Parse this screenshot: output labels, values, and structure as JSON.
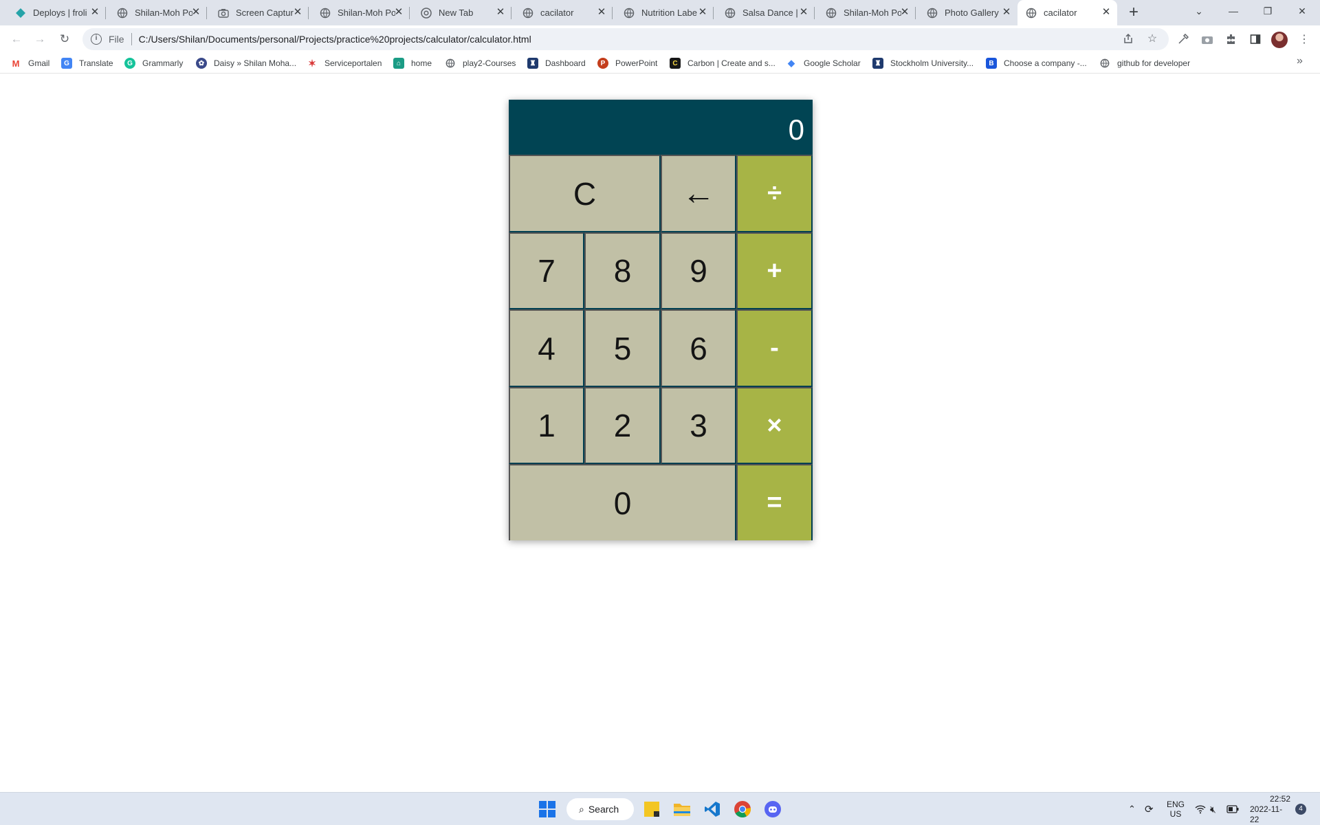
{
  "browser": {
    "tabs": [
      {
        "title": "Deploys | froli",
        "icon": "netlify-icon",
        "active": false
      },
      {
        "title": "Shilan-Moh Po",
        "icon": "globe-icon",
        "active": false
      },
      {
        "title": "Screen Captur",
        "icon": "camera-icon",
        "active": false
      },
      {
        "title": "Shilan-Moh Po",
        "icon": "globe-icon",
        "active": false
      },
      {
        "title": "New Tab",
        "icon": "chrome-icon",
        "active": false
      },
      {
        "title": "cacilator",
        "icon": "globe-icon",
        "active": false
      },
      {
        "title": "Nutrition Labe",
        "icon": "globe-icon",
        "active": false
      },
      {
        "title": "Salsa Dance |",
        "icon": "globe-icon",
        "active": false
      },
      {
        "title": "Shilan-Moh Po",
        "icon": "globe-icon",
        "active": false
      },
      {
        "title": "Photo Gallery",
        "icon": "globe-icon",
        "active": false
      },
      {
        "title": "cacilator",
        "icon": "globe-icon",
        "active": true
      }
    ],
    "omnibox": {
      "scheme": "File",
      "url": "C:/Users/Shilan/Documents/personal/Projects/practice%20projects/calculator/calculator.html"
    },
    "bookmarks": [
      {
        "label": "Gmail",
        "icon": "gmail-icon",
        "color": "#ea4335"
      },
      {
        "label": "Translate",
        "icon": "translate-icon",
        "color": "#4285f4"
      },
      {
        "label": "Grammarly",
        "icon": "grammarly-icon",
        "color": "#15c39a"
      },
      {
        "label": "Daisy » Shilan Moha...",
        "icon": "daisy-icon",
        "color": "#3b4a8a"
      },
      {
        "label": "Serviceportalen",
        "icon": "star-logo-icon",
        "color": "#d93a3a"
      },
      {
        "label": "home",
        "icon": "home-logo-icon",
        "color": "#1b9c85"
      },
      {
        "label": "play2-Courses",
        "icon": "globe-icon",
        "color": "#5f6368"
      },
      {
        "label": "Dashboard",
        "icon": "university-icon",
        "color": "#1f3a6e"
      },
      {
        "label": "PowerPoint",
        "icon": "powerpoint-icon",
        "color": "#c43e1c"
      },
      {
        "label": "Carbon | Create and s...",
        "icon": "carbon-icon",
        "color": "#171717"
      },
      {
        "label": "Google Scholar",
        "icon": "scholar-icon",
        "color": "#4285f4"
      },
      {
        "label": "Stockholm University...",
        "icon": "university-icon",
        "color": "#1f3a6e"
      },
      {
        "label": "Choose a company -...",
        "icon": "b-logo-icon",
        "color": "#1a56db"
      },
      {
        "label": "github for developer",
        "icon": "globe-icon",
        "color": "#5f6368"
      }
    ]
  },
  "calculator": {
    "display": "0",
    "keys": {
      "clear": "C",
      "backspace": "←",
      "divide": "÷",
      "seven": "7",
      "eight": "8",
      "nine": "9",
      "add": "+",
      "four": "4",
      "five": "5",
      "six": "6",
      "subtract": "-",
      "one": "1",
      "two": "2",
      "three": "3",
      "multiply": "×",
      "zero": "0",
      "equals": "="
    },
    "colors": {
      "display_bg": "#014453",
      "key_bg": "#c1c0a6",
      "operator_bg": "#a7b446",
      "border": "#013f51"
    }
  },
  "taskbar": {
    "search_label": "Search",
    "language": "ENG",
    "region": "US",
    "time": "22:52",
    "date": "2022-11-22",
    "notification_count": "4"
  }
}
